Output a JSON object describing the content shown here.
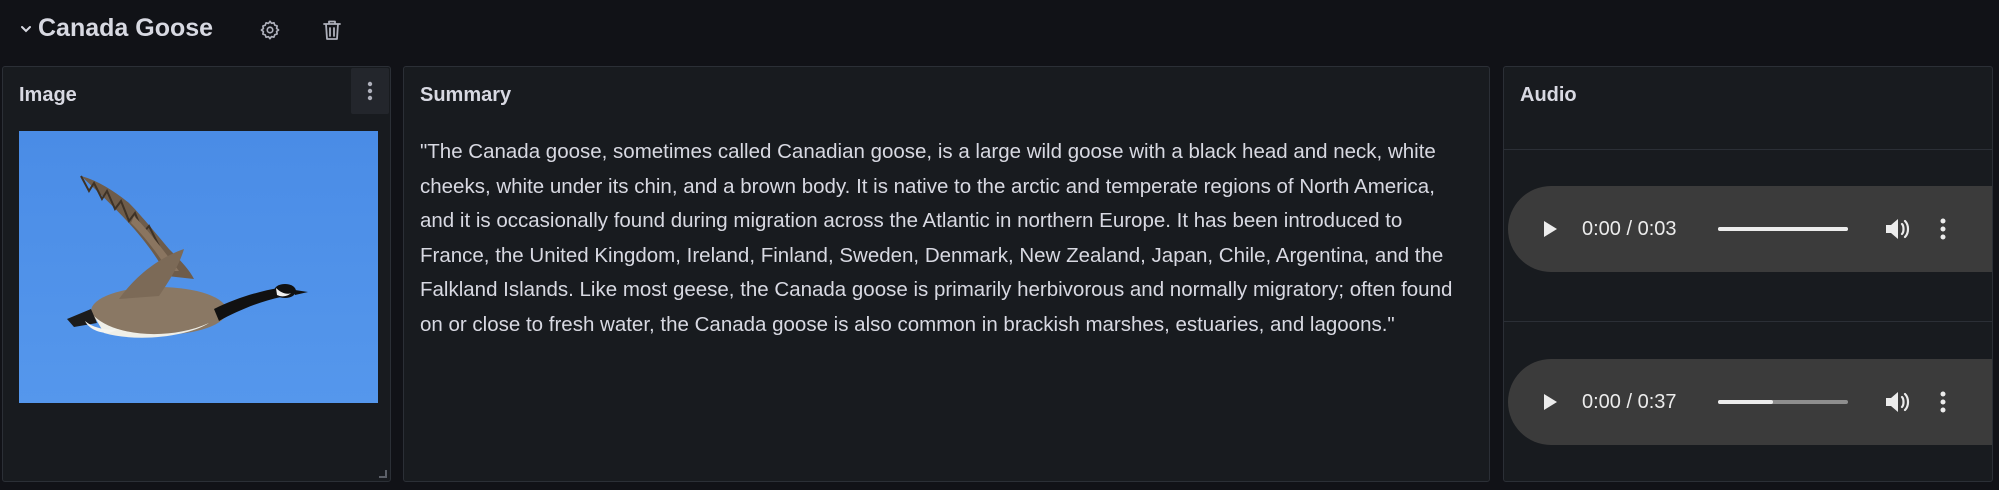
{
  "row": {
    "title": "Canada Goose",
    "icons": [
      "chevron-down-icon",
      "gear-icon",
      "trash-icon"
    ]
  },
  "panels": {
    "image": {
      "title": "Image"
    },
    "summary": {
      "title": "Summary",
      "text": "\"The Canada goose, sometimes called Canadian goose, is a large wild goose with a black head and neck, white cheeks, white under its chin, and a brown body. It is native to the arctic and temperate regions of North America, and it is occasionally found during migration across the Atlantic in northern Europe. It has been introduced to France, the United Kingdom, Ireland, Finland, Sweden, Denmark, New Zealand, Japan, Chile, Argentina, and the Falkland Islands. Like most geese, the Canada goose is primarily herbivorous and normally migratory; often found on or close to fresh water, the Canada goose is also common in brackish marshes, estuaries, and lagoons.\""
    },
    "audio": {
      "title": "Audio",
      "players": [
        {
          "time": "0:00 / 0:03",
          "progress": 1.0
        },
        {
          "time": "0:00 / 0:37",
          "progress": 0.42
        }
      ]
    }
  },
  "colors": {
    "background": "#111217",
    "panel": "#181b1f",
    "player": "#3b3b3b",
    "sky": "#4e90e8"
  }
}
